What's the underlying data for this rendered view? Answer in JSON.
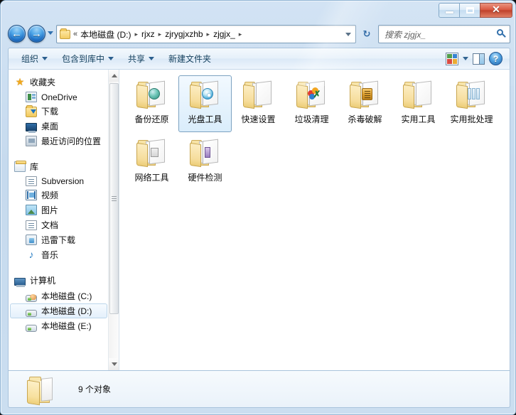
{
  "window": {
    "controls": {
      "minimize": "—",
      "maximize": "❐",
      "close": "✕"
    }
  },
  "navigation": {
    "back_label": "◀",
    "forward_label": "▶",
    "recent_dropdown_label": "▾",
    "refresh_label": "↻"
  },
  "address_bar": {
    "overflow_label": "«",
    "separator": "▸",
    "crumbs": [
      "本地磁盘 (D:)",
      "rjxz",
      "zjrygjxzhb",
      "zjgjx_"
    ],
    "dropdown_label": "▾"
  },
  "search": {
    "placeholder": "搜索 zjgjx_",
    "icon": "search-icon"
  },
  "toolbar": {
    "items": [
      {
        "label": "组织",
        "has_caret": true
      },
      {
        "label": "包含到库中",
        "has_caret": true
      },
      {
        "label": "共享",
        "has_caret": true
      },
      {
        "label": "新建文件夹",
        "has_caret": false
      }
    ],
    "view_icon": "view-options-icon",
    "view_caret": "▾",
    "preview_pane_icon": "preview-pane-icon",
    "help_icon": "help-icon",
    "help_label": "?"
  },
  "sidebar": {
    "groups": [
      {
        "name": "收藏夹",
        "icon": "star-icon",
        "items": [
          {
            "label": "OneDrive",
            "icon": "onedrive-icon"
          },
          {
            "label": "下载",
            "icon": "downloads-folder-icon"
          },
          {
            "label": "桌面",
            "icon": "desktop-icon"
          },
          {
            "label": "最近访问的位置",
            "icon": "recent-places-icon"
          }
        ]
      },
      {
        "name": "库",
        "icon": "library-icon",
        "items": [
          {
            "label": "Subversion",
            "icon": "document-icon"
          },
          {
            "label": "视频",
            "icon": "video-icon"
          },
          {
            "label": "图片",
            "icon": "pictures-icon"
          },
          {
            "label": "文档",
            "icon": "document-icon"
          },
          {
            "label": "迅雷下载",
            "icon": "xunlei-icon"
          },
          {
            "label": "音乐",
            "icon": "music-icon"
          }
        ]
      },
      {
        "name": "计算机",
        "icon": "computer-icon",
        "items": [
          {
            "label": "本地磁盘 (C:)",
            "icon": "system-drive-icon",
            "selected": false
          },
          {
            "label": "本地磁盘 (D:)",
            "icon": "drive-icon",
            "selected": true
          },
          {
            "label": "本地磁盘 (E:)",
            "icon": "drive-icon",
            "selected": false
          }
        ]
      }
    ]
  },
  "content": {
    "items": [
      {
        "label": "备份还原",
        "emblem": "globe",
        "selected": false
      },
      {
        "label": "光盘工具",
        "emblem": "disc",
        "selected": true
      },
      {
        "label": "快速设置",
        "emblem": "plain",
        "selected": false
      },
      {
        "label": "垃圾清理",
        "emblem": "clean",
        "selected": false
      },
      {
        "label": "杀毒破解",
        "emblem": "kill",
        "selected": false
      },
      {
        "label": "实用工具",
        "emblem": "plain",
        "selected": false
      },
      {
        "label": "实用批处理",
        "emblem": "batch",
        "selected": false
      },
      {
        "label": "网络工具",
        "emblem": "net",
        "selected": false
      },
      {
        "label": "硬件检测",
        "emblem": "hw",
        "selected": false
      }
    ]
  },
  "status": {
    "text": "9 个对象",
    "icon": "folder-icon"
  },
  "colors": {
    "frame": "#c9dcf0",
    "accent": "#1f6fc4",
    "close_button": "#d9543c",
    "selection": "#daedfb",
    "folder": "#f2c95c"
  }
}
